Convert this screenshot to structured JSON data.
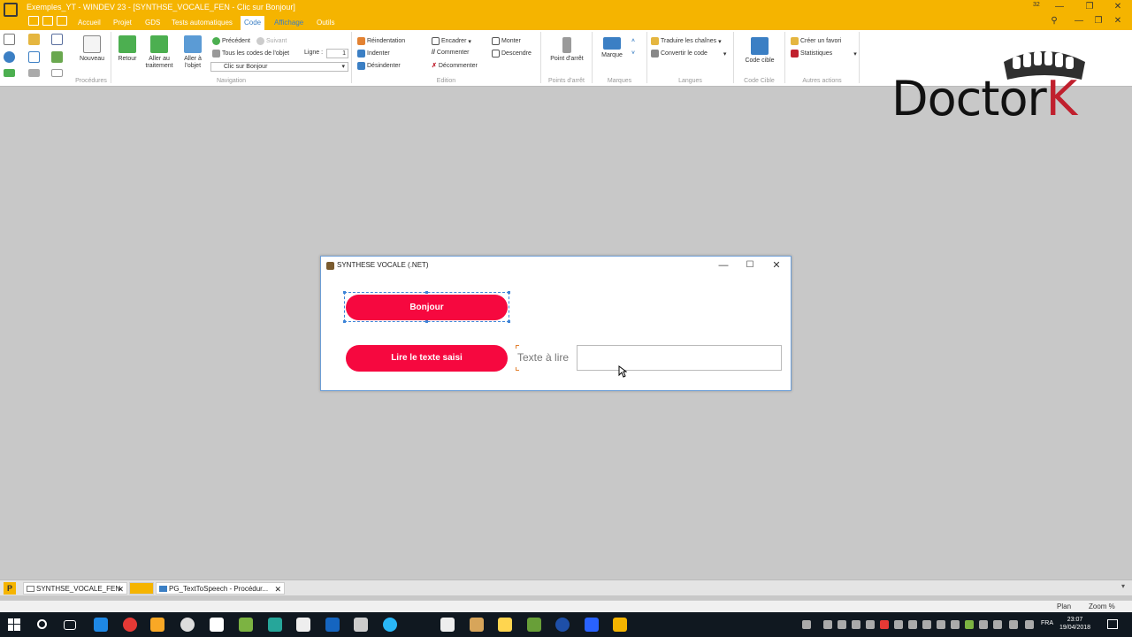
{
  "window": {
    "title": "Exemples_YT - WINDEV 23 - [SYNTHSE_VOCALE_FEN - Clic sur Bonjour]",
    "notif_count": "32"
  },
  "menu": {
    "tabs": [
      {
        "label": "Accueil"
      },
      {
        "label": "Projet"
      },
      {
        "label": "GDS"
      },
      {
        "label": "Tests automatiques"
      },
      {
        "label": "Code"
      },
      {
        "label": "Affichage"
      },
      {
        "label": "Outils"
      }
    ],
    "active_tab": "Code"
  },
  "ribbon": {
    "procedures": {
      "label": "Procédures",
      "nouveau": "Nouveau"
    },
    "navigation": {
      "label": "Navigation",
      "retour": "Retour",
      "aller_traitement": "Aller au traitement",
      "aller_objet": "Aller à l'objet",
      "precedent": "Précédent",
      "suivant": "Suivant",
      "tous_codes": "Tous les codes de l'objet",
      "ligne_label": "Ligne :",
      "ligne_value": "1",
      "dropdown": "Clic sur Bonjour"
    },
    "edition": {
      "label": "Edition",
      "reindentation": "Réindentation",
      "indenter": "Indenter",
      "desindenter": "Désindenter",
      "encadrer": "Encadrer",
      "commenter": "Commenter",
      "decommenter": "Décommenter",
      "monter": "Monter",
      "descendre": "Descendre"
    },
    "points_arret": {
      "label": "Points d'arrêt",
      "btn": "Point d'arrêt"
    },
    "marques": {
      "label": "Marques",
      "btn": "Marque"
    },
    "langues": {
      "label": "Langues",
      "traduire": "Traduire les chaînes",
      "convertir": "Convertir le code"
    },
    "code_cible": {
      "label": "Code Cible",
      "btn": "Code cible"
    },
    "autres": {
      "label": "Autres actions",
      "favori": "Créer un favori",
      "stats": "Statistiques"
    }
  },
  "brand": {
    "main": "Doctor",
    "accent": "K"
  },
  "dialog": {
    "title": "SYNTHESE VOCALE (.NET)",
    "bonjour_button": "Bonjour",
    "lire_button": "Lire le texte saisi",
    "field_label": "Texte à lire",
    "field_value": ""
  },
  "doc_tabs": [
    {
      "label": "SYNTHSE_VOCALE_FEN"
    },
    {
      "label": "PG_TextToSpeech - Procédur..."
    }
  ],
  "status": {
    "plan": "Plan",
    "zoom": "Zoom %"
  },
  "taskbar": {
    "lang": "FRA",
    "time": "23:07",
    "date": "19/04/2018"
  },
  "colors": {
    "titlebar": "#f5b400",
    "accent_button": "#f6083f",
    "selection": "#3e85d8"
  }
}
